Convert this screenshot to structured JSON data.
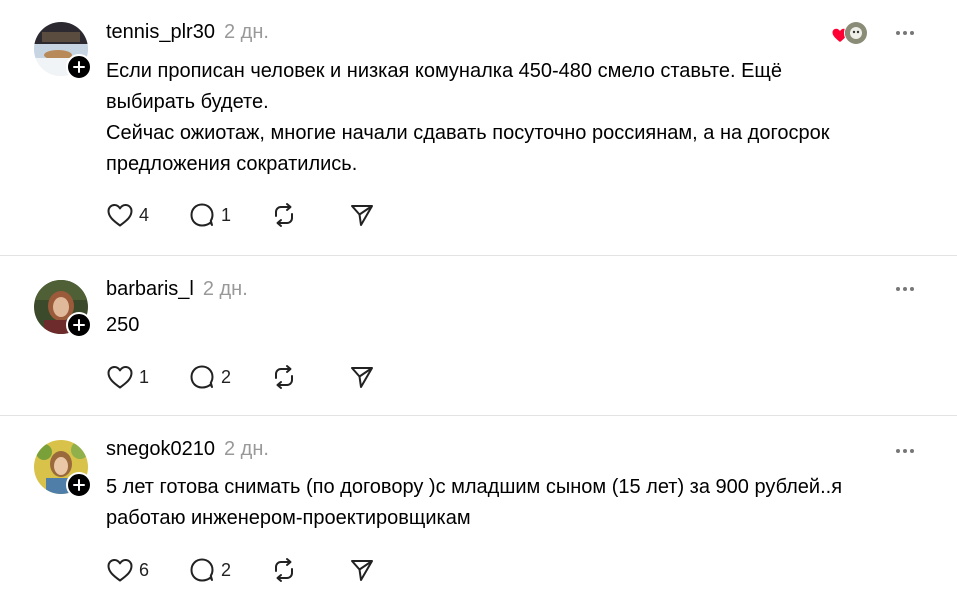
{
  "posts": [
    {
      "username": "tennis_plr30",
      "time": "2 дн.",
      "lines": [
        "Если прописан человек и низкая комуналка 450-480 смело ставьте. Ещё выбирать будете.",
        "Сейчас ожиотаж, многие начали сдавать посуточно россиянам, а на догосрок предложения сократились."
      ],
      "likes": "4",
      "replies": "1"
    },
    {
      "username": "barbaris_l",
      "time": "2 дн.",
      "lines": [
        "250"
      ],
      "likes": "1",
      "replies": "2"
    },
    {
      "username": "snegok0210",
      "time": "2 дн.",
      "lines": [
        "5 лет готова снимать (по договору )с младшим сыном (15 лет) за 900 рублей..я работаю инженером-проектировщикам"
      ],
      "likes": "6",
      "replies": "2"
    }
  ],
  "colors": {
    "text": "#000000",
    "muted": "#999999",
    "divider": "#e3e3e3",
    "heart": "#ff0034"
  },
  "icons": [
    "heart-icon",
    "comment-icon",
    "repost-icon",
    "share-icon",
    "more-icon",
    "plus-icon"
  ]
}
